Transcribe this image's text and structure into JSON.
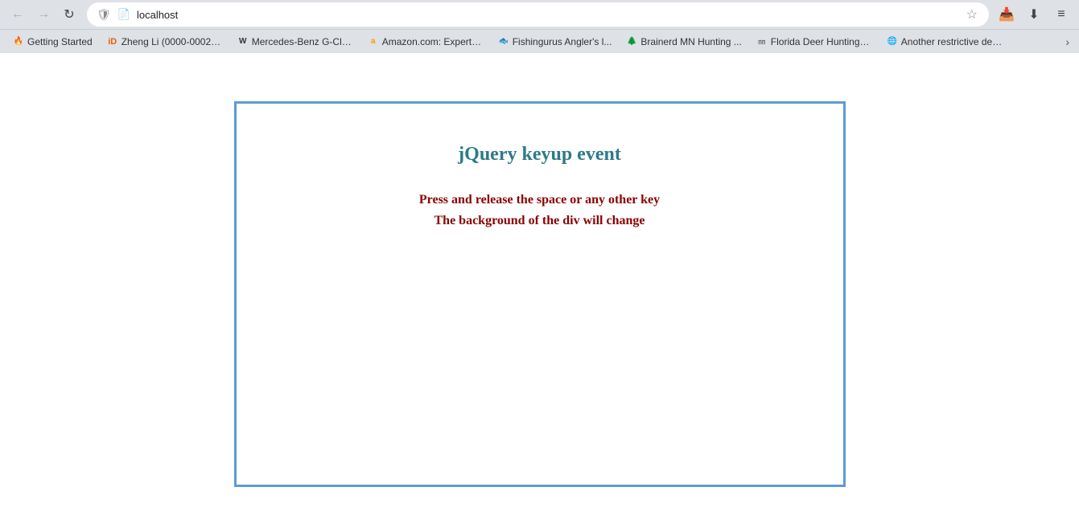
{
  "browser": {
    "url": "localhost",
    "title": "Getting Started"
  },
  "titlebar": {
    "back_label": "←",
    "forward_label": "→",
    "refresh_label": "↻",
    "shield_icon": "🛡",
    "page_icon": "📄",
    "star_icon": "☆",
    "download_icon": "⬇",
    "menu_icon": "≡",
    "pocket_icon": "📥"
  },
  "bookmarks": [
    {
      "id": "b1",
      "favicon": "🔥",
      "label": "Getting Started"
    },
    {
      "id": "b2",
      "favicon": "🟠",
      "label": "Zheng Li (0000-0002-3..."
    },
    {
      "id": "b3",
      "favicon": "W",
      "label": "Mercedes-Benz G-Clas..."
    },
    {
      "id": "b4",
      "favicon": "a",
      "label": "Amazon.com: ExpertP..."
    },
    {
      "id": "b5",
      "favicon": "🐟",
      "label": "Fishingurus Angler's l..."
    },
    {
      "id": "b6",
      "favicon": "🌲",
      "label": "Brainerd MN Hunting ..."
    },
    {
      "id": "b7",
      "favicon": "㎜",
      "label": "Florida Deer Hunting S..."
    },
    {
      "id": "b8",
      "favicon": "🌐",
      "label": "Another restrictive dee..."
    }
  ],
  "bookmarks_more": "›",
  "page": {
    "title": "jQuery keyup event",
    "instruction_line1": "Press and release the space or any other key",
    "instruction_line2": "The background of the div will change"
  }
}
